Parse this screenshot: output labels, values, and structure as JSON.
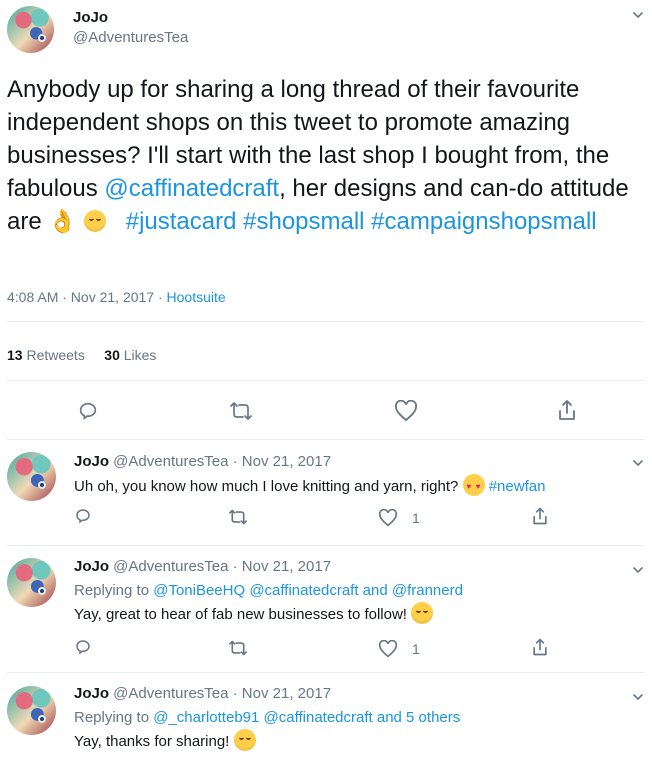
{
  "main": {
    "name": "JoJo",
    "handle": "@AdventuresTea",
    "text_1": "Anybody up for sharing a long thread of their favourite independent shops on this tweet to promote amazing businesses? I'll start with the last shop I bought from, the fabulous ",
    "mention": "@caffinatedcraft",
    "text_2": ", her designs and can-do attitude are ",
    "hashtags": "#justacard #shopsmall #campaignshopsmall",
    "time": "4:08 AM · Nov 21, 2017 · ",
    "source": "Hootsuite",
    "retweets": "13",
    "retweets_label": " Retweets",
    "likes": "30",
    "likes_label": " Likes"
  },
  "replies": [
    {
      "name": "JoJo",
      "meta": " @AdventuresTea · Nov 21, 2017",
      "text": "Uh oh, you know how much I love knitting and yarn, right? ",
      "hashtag": "#newfan",
      "likes": "1"
    },
    {
      "name": "JoJo",
      "meta": " @AdventuresTea · Nov 21, 2017",
      "replying": "Replying to ",
      "to": "@ToniBeeHQ @caffinatedcraft and @frannerd",
      "text": "Yay, great to hear of fab new businesses to follow! ",
      "likes": "1"
    },
    {
      "name": "JoJo",
      "meta": " @AdventuresTea · Nov 21, 2017",
      "replying": "Replying to ",
      "to": "@_charlotteb91 @caffinatedcraft and 5 others",
      "text": "Yay, thanks for sharing! "
    }
  ],
  "icons": {
    "reply": "reply-icon",
    "retweet": "retweet-icon",
    "like": "heart-icon",
    "share": "share-icon",
    "chevron": "chevron-down-icon"
  },
  "colors": {
    "link": "#1b95e0",
    "muted": "#657786",
    "divider": "#e6ecf0"
  }
}
